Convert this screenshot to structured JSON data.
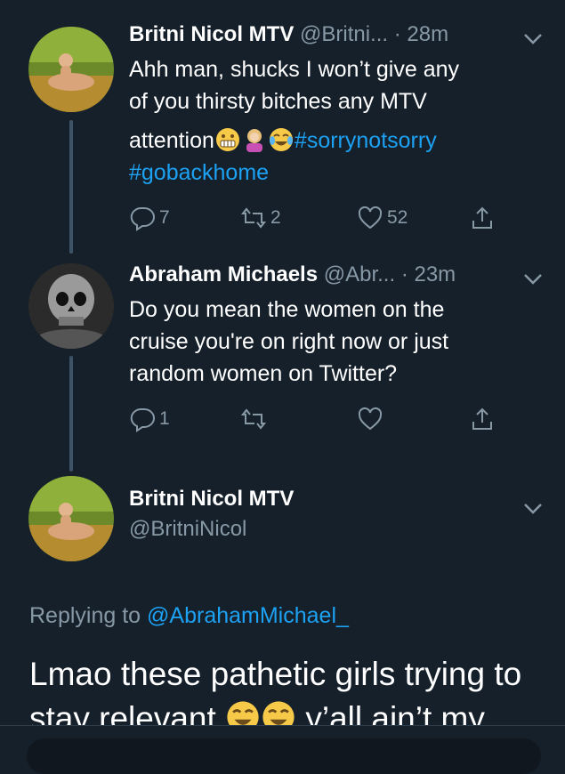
{
  "tweets": [
    {
      "name": "Britni Nicol MTV",
      "handle": "@Britni...",
      "time": "· 28m",
      "text_line1": "Ahh man, shucks I won’t give any",
      "text_line2": "of you thirsty bitches any MTV",
      "text_line3_prefix": "attention",
      "hashtag1": "#sorrynotsorry",
      "hashtag2": "#gobackhome",
      "replies": "7",
      "retweets": "2",
      "likes": "52"
    },
    {
      "name": "Abraham Michaels",
      "handle": "@Abr...",
      "time": "· 23m",
      "text_line1": "Do you mean the women on the",
      "text_line2": "cruise you're on right now or just",
      "text_line3": "random women on Twitter?",
      "replies": "1",
      "retweets": "",
      "likes": ""
    }
  ],
  "main_tweet": {
    "name": "Britni Nicol MTV",
    "handle": "@BritniNicol",
    "replying_prefix": "Replying to",
    "replying_handle": "@AbrahamMichael_",
    "text_line1": "Lmao these pathetic girls trying to",
    "text_line2_visible": "stay relevant",
    "text_line2_suffix": "y’all ain’t my"
  },
  "colors": {
    "background": "#15202b",
    "link": "#1da1f2",
    "secondary": "#8899a6"
  },
  "icons": [
    "reply-icon",
    "retweet-icon",
    "like-icon",
    "share-icon",
    "chevron-down-icon"
  ]
}
